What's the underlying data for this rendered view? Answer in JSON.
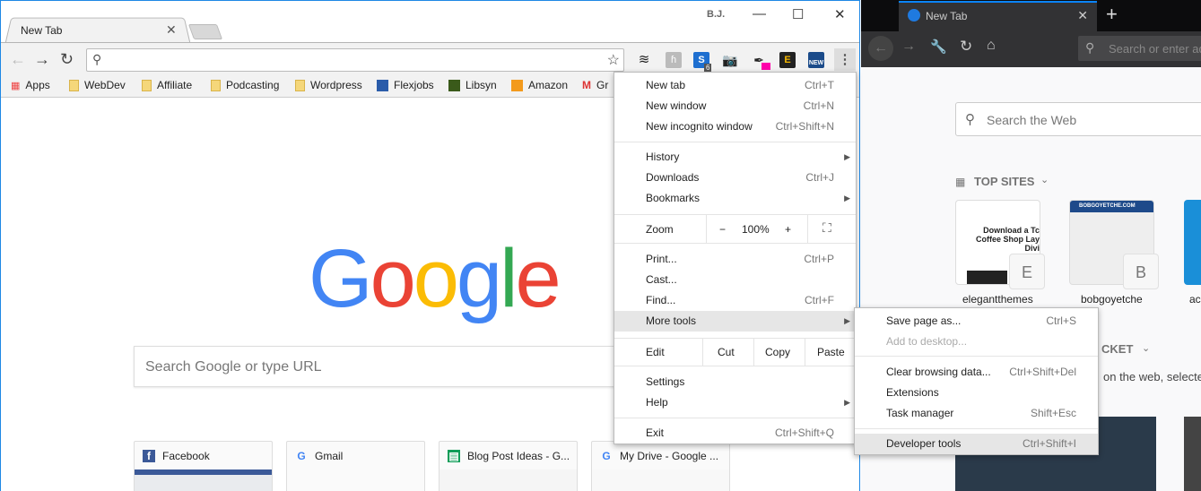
{
  "chrome": {
    "tab_title": "New Tab",
    "user": "B.J.",
    "omnibox_placeholder": "",
    "extensions": {
      "s_badge": "6",
      "new_label": "NEW"
    },
    "bookmarks": [
      "Apps",
      "WebDev",
      "Affiliate",
      "Podcasting",
      "Wordpress",
      "Flexjobs",
      "Libsyn",
      "Amazon",
      "Gr"
    ],
    "google_logo": [
      "G",
      "o",
      "o",
      "g",
      "l",
      "e"
    ],
    "google_colors": [
      "#4285f4",
      "#ea4335",
      "#fbbc05",
      "#4285f4",
      "#34a853",
      "#ea4335"
    ],
    "search_placeholder": "Search Google or type URL",
    "tiles": [
      "Facebook",
      "Gmail",
      "Blog Post Ideas - G...",
      "My Drive - Google ..."
    ],
    "menu": {
      "new_tab": {
        "label": "New tab",
        "shortcut": "Ctrl+T"
      },
      "new_window": {
        "label": "New window",
        "shortcut": "Ctrl+N"
      },
      "incognito": {
        "label": "New incognito window",
        "shortcut": "Ctrl+Shift+N"
      },
      "history": "History",
      "downloads": {
        "label": "Downloads",
        "shortcut": "Ctrl+J"
      },
      "bookmarks": "Bookmarks",
      "zoom": {
        "label": "Zoom",
        "minus": "−",
        "value": "100%",
        "plus": "+"
      },
      "print": {
        "label": "Print...",
        "shortcut": "Ctrl+P"
      },
      "cast": "Cast...",
      "find": {
        "label": "Find...",
        "shortcut": "Ctrl+F"
      },
      "more_tools": "More tools",
      "edit": {
        "label": "Edit",
        "cut": "Cut",
        "copy": "Copy",
        "paste": "Paste"
      },
      "settings": "Settings",
      "help": "Help",
      "exit": {
        "label": "Exit",
        "shortcut": "Ctrl+Shift+Q"
      }
    },
    "submenu": {
      "save": {
        "label": "Save page as...",
        "shortcut": "Ctrl+S"
      },
      "desktop": "Add to desktop...",
      "clear": {
        "label": "Clear browsing data...",
        "shortcut": "Ctrl+Shift+Del"
      },
      "extensions": "Extensions",
      "task": {
        "label": "Task manager",
        "shortcut": "Shift+Esc"
      },
      "devtools": {
        "label": "Developer tools",
        "shortcut": "Ctrl+Shift+I"
      }
    }
  },
  "firefox": {
    "tab_title": "New Tab",
    "url_placeholder": "Search or enter address",
    "search_placeholder": "Search the Web",
    "top_sites_label": "TOP SITES",
    "sites": [
      {
        "label": "elegantthemes",
        "letter": "E",
        "preview": "Download a Tc Coffee Shop Lay Divi"
      },
      {
        "label": "bobgoyetche",
        "letter": "B",
        "preview": "BOBGOYETCHE.COM"
      },
      {
        "label": "ac"
      }
    ],
    "pocket_heading": "CKET",
    "pocket_text": "on the web, selecte"
  }
}
